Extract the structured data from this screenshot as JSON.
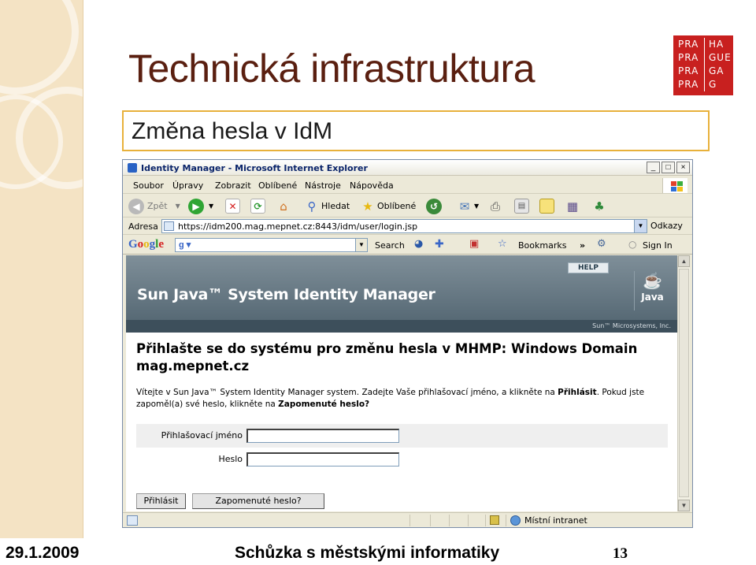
{
  "slide": {
    "title": "Technická infrastruktura",
    "subtitle": "Změna hesla v IdM",
    "logo": [
      [
        "PRA",
        "HA"
      ],
      [
        "PRA",
        "GUE"
      ],
      [
        "PRA",
        "GA"
      ],
      [
        "PRA",
        "G"
      ]
    ],
    "footer": {
      "date": "29.1.2009",
      "center": "Schůzka s městskými informatiky",
      "page": "13"
    },
    "colors": {
      "title": "#5a1f10",
      "subtitle_border": "#e8b13b",
      "logo_bg": "#c8201f",
      "side_band": "#f4e3c4"
    }
  },
  "browser": {
    "title": "Identity Manager - Microsoft Internet Explorer",
    "window_buttons": [
      "_",
      "□",
      "×"
    ],
    "menu": [
      "Soubor",
      "Úpravy",
      "Zobrazit",
      "Oblíbené",
      "Nástroje",
      "Nápověda"
    ],
    "toolbar": {
      "back_label": "Zpět",
      "search_label": "Hledat",
      "favorites_label": "Oblíbené"
    },
    "address": {
      "label": "Adresa",
      "url": "https://idm200.mag.mepnet.cz:8443/idm/user/login.jsp",
      "go_label": "Odkazy"
    },
    "google_bar": {
      "logo": "Google",
      "search_label": "Search",
      "bookmarks_label": "Bookmarks",
      "more": "»",
      "signin_label": "Sign In"
    },
    "status": {
      "zone": "Místní intranet"
    }
  },
  "page": {
    "help_label": "HELP",
    "product_title": "Sun Java™ System Identity Manager",
    "java_label": "Java",
    "vendor": "Sun™ Microsystems, Inc.",
    "heading": "Přihlašte se do systému pro změnu hesla v MHMP: Windows Domain mag.mepnet.cz",
    "intro_part1": "Vítejte v Sun Java™ System Identity Manager system. Zadejte Vaše přihlašovací jméno, a klikněte na ",
    "intro_bold1": "Přihlásit",
    "intro_part2": ". Pokud jste zapoměl(a) své heslo, klikněte na ",
    "intro_bold2": "Zapomenuté heslo?",
    "form": {
      "username_label": "Přihlašovací jméno",
      "password_label": "Heslo",
      "username_value": "",
      "password_value": ""
    },
    "buttons": {
      "login": "Přihlásit",
      "forgot": "Zapomenuté heslo?"
    },
    "colors": {
      "header_top": "#7f8f99",
      "header_bottom": "#4f626e"
    }
  }
}
